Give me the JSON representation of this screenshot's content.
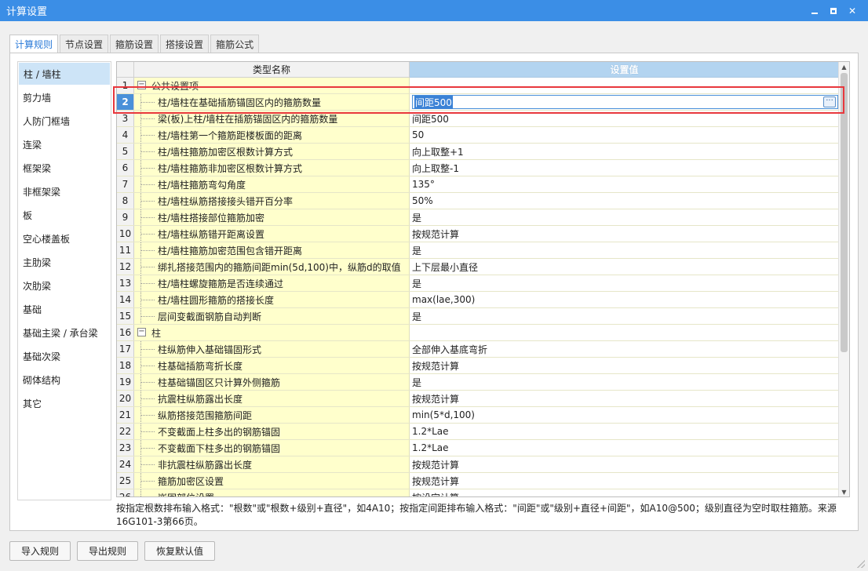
{
  "window": {
    "title": "计算设置",
    "minimize_label": "",
    "maximize_label": "",
    "close_label": "✕"
  },
  "tabs": [
    {
      "label": "计算规则",
      "active": true
    },
    {
      "label": "节点设置",
      "active": false
    },
    {
      "label": "箍筋设置",
      "active": false
    },
    {
      "label": "搭接设置",
      "active": false
    },
    {
      "label": "箍筋公式",
      "active": false
    }
  ],
  "sidebar": {
    "items": [
      {
        "label": "柱 / 墙柱",
        "active": true
      },
      {
        "label": "剪力墙"
      },
      {
        "label": "人防门框墙"
      },
      {
        "label": "连梁"
      },
      {
        "label": "框架梁"
      },
      {
        "label": "非框架梁"
      },
      {
        "label": "板"
      },
      {
        "label": "空心楼盖板"
      },
      {
        "label": "主肋梁"
      },
      {
        "label": "次肋梁"
      },
      {
        "label": "基础"
      },
      {
        "label": "基础主梁 / 承台梁"
      },
      {
        "label": "基础次梁"
      },
      {
        "label": "砌体结构"
      },
      {
        "label": "其它"
      }
    ]
  },
  "grid": {
    "header": {
      "name": "类型名称",
      "value": "设置值"
    },
    "rows": [
      {
        "num": "1",
        "name": "公共设置项",
        "value": "",
        "group": true
      },
      {
        "num": "2",
        "name": "柱/墙柱在基础插筋锚固区内的箍筋数量",
        "value": "间距500",
        "selected": true
      },
      {
        "num": "3",
        "name": "梁(板)上柱/墙柱在插筋锚固区内的箍筋数量",
        "value": "间距500"
      },
      {
        "num": "4",
        "name": "柱/墙柱第一个箍筋距楼板面的距离",
        "value": "50"
      },
      {
        "num": "5",
        "name": "柱/墙柱箍筋加密区根数计算方式",
        "value": "向上取整+1"
      },
      {
        "num": "6",
        "name": "柱/墙柱箍筋非加密区根数计算方式",
        "value": "向上取整-1"
      },
      {
        "num": "7",
        "name": "柱/墙柱箍筋弯勾角度",
        "value": "135°"
      },
      {
        "num": "8",
        "name": "柱/墙柱纵筋搭接接头错开百分率",
        "value": "50%"
      },
      {
        "num": "9",
        "name": "柱/墙柱搭接部位箍筋加密",
        "value": "是"
      },
      {
        "num": "10",
        "name": "柱/墙柱纵筋错开距离设置",
        "value": "按规范计算"
      },
      {
        "num": "11",
        "name": "柱/墙柱箍筋加密范围包含错开距离",
        "value": "是"
      },
      {
        "num": "12",
        "name": "绑扎搭接范围内的箍筋间距min(5d,100)中，纵筋d的取值",
        "value": "上下层最小直径"
      },
      {
        "num": "13",
        "name": "柱/墙柱螺旋箍筋是否连续通过",
        "value": "是"
      },
      {
        "num": "14",
        "name": "柱/墙柱圆形箍筋的搭接长度",
        "value": "max(lae,300)"
      },
      {
        "num": "15",
        "name": "层间变截面钢筋自动判断",
        "value": "是"
      },
      {
        "num": "16",
        "name": "柱",
        "value": "",
        "group": true
      },
      {
        "num": "17",
        "name": "柱纵筋伸入基础锚固形式",
        "value": "全部伸入基底弯折"
      },
      {
        "num": "18",
        "name": "柱基础插筋弯折长度",
        "value": "按规范计算"
      },
      {
        "num": "19",
        "name": "柱基础锚固区只计算外侧箍筋",
        "value": "是"
      },
      {
        "num": "20",
        "name": "抗震柱纵筋露出长度",
        "value": "按规范计算"
      },
      {
        "num": "21",
        "name": "纵筋搭接范围箍筋间距",
        "value": "min(5*d,100)"
      },
      {
        "num": "22",
        "name": "不变截面上柱多出的钢筋锚固",
        "value": "1.2*Lae"
      },
      {
        "num": "23",
        "name": "不变截面下柱多出的钢筋锚固",
        "value": "1.2*Lae"
      },
      {
        "num": "24",
        "name": "非抗震柱纵筋露出长度",
        "value": "按规范计算"
      },
      {
        "num": "25",
        "name": "箍筋加密区设置",
        "value": "按规范计算"
      },
      {
        "num": "26",
        "name": "嵌固部位设置",
        "value": "按设定计算"
      }
    ]
  },
  "hint": "按指定根数排布输入格式：\"根数\"或\"根数+级别+直径\"，如4A10；按指定间距排布输入格式：\"间距\"或\"级别+直径+间距\"，如A10@500；级别直径为空时取柱箍筋。来源16G101-3第66页。",
  "buttons": {
    "import": "导入规则",
    "export": "导出规则",
    "restore": "恢复默认值"
  },
  "colors": {
    "titlebar": "#3b8ee6",
    "name_column_bg": "#ffffcc",
    "highlight_border": "#e8383d",
    "selected_row_num": "#4a90d9"
  }
}
